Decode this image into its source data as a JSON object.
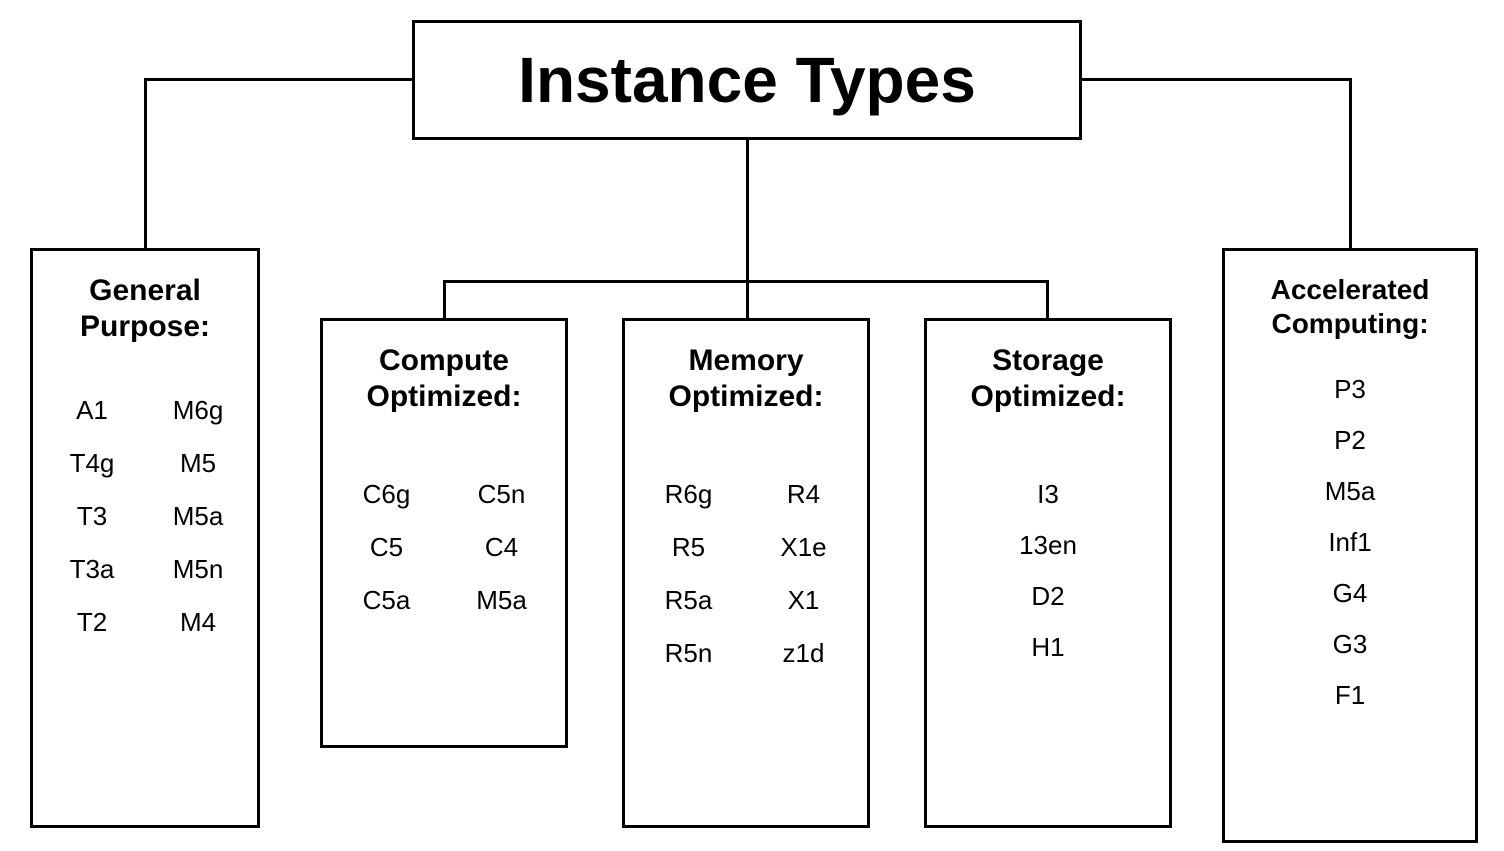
{
  "root": {
    "title": "Instance Types"
  },
  "categories": {
    "general": {
      "title_l1": "General",
      "title_l2": "Purpose:",
      "col1": [
        "A1",
        "T4g",
        "T3",
        "T3a",
        "T2"
      ],
      "col2": [
        "M6g",
        "M5",
        "M5a",
        "M5n",
        "M4"
      ]
    },
    "compute": {
      "title_l1": "Compute",
      "title_l2": "Optimized:",
      "col1": [
        "C6g",
        "C5",
        "C5a"
      ],
      "col2": [
        "C5n",
        "C4",
        "M5a"
      ]
    },
    "memory": {
      "title_l1": "Memory",
      "title_l2": "Optimized:",
      "col1": [
        "R6g",
        "R5",
        "R5a",
        "R5n"
      ],
      "col2": [
        "R4",
        "X1e",
        "X1",
        "z1d"
      ]
    },
    "storage": {
      "title_l1": "Storage",
      "title_l2": "Optimized:",
      "items": [
        "I3",
        "13en",
        "D2",
        "H1"
      ]
    },
    "accelerated": {
      "title_l1": "Accelerated",
      "title_l2": "Computing:",
      "items": [
        "P3",
        "P2",
        "M5a",
        "Inf1",
        "G4",
        "G3",
        "F1"
      ]
    }
  }
}
